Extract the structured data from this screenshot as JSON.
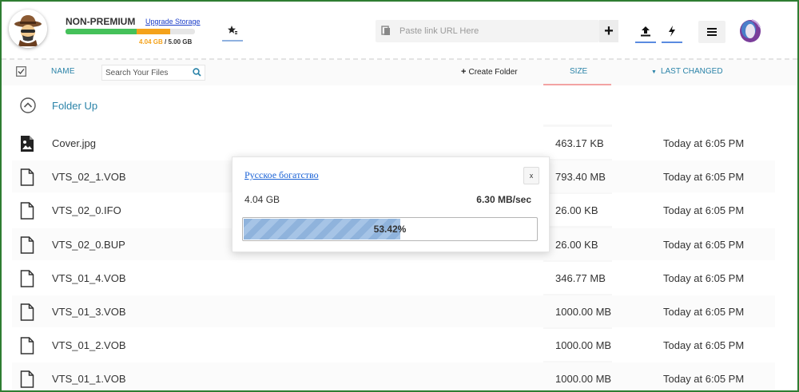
{
  "header": {
    "plan_label": "NON-PREMIUM",
    "upgrade_label": "Upgrade Storage",
    "storage_used": "4.04 GB",
    "storage_separator": " / ",
    "storage_total": "5.00 GB",
    "storage_fraction": 0.808,
    "url_placeholder": "Paste link URL Here",
    "add_label": "+"
  },
  "toolbar": {
    "name_label": "NAME",
    "search_placeholder": "Search Your Files",
    "create_folder_label": "Create Folder",
    "size_label": "SIZE",
    "last_changed_label": "LAST CHANGED"
  },
  "list": {
    "folder_up_label": "Folder Up",
    "files": [
      {
        "name": "Cover.jpg",
        "size": "463.17 KB",
        "date": "Today at 6:05 PM",
        "icon": "image-file-icon"
      },
      {
        "name": "VTS_02_1.VOB",
        "size": "793.40 MB",
        "date": "Today at 6:05 PM",
        "icon": "file-icon"
      },
      {
        "name": "VTS_02_0.IFO",
        "size": "26.00 KB",
        "date": "Today at 6:05 PM",
        "icon": "file-icon"
      },
      {
        "name": "VTS_02_0.BUP",
        "size": "26.00 KB",
        "date": "Today at 6:05 PM",
        "icon": "file-icon"
      },
      {
        "name": "VTS_01_4.VOB",
        "size": "346.77 MB",
        "date": "Today at 6:05 PM",
        "icon": "file-icon"
      },
      {
        "name": "VTS_01_3.VOB",
        "size": "1000.00 MB",
        "date": "Today at 6:05 PM",
        "icon": "file-icon"
      },
      {
        "name": "VTS_01_2.VOB",
        "size": "1000.00 MB",
        "date": "Today at 6:05 PM",
        "icon": "file-icon"
      },
      {
        "name": "VTS_01_1.VOB",
        "size": "1000.00 MB",
        "date": "Today at 6:05 PM",
        "icon": "file-icon"
      }
    ]
  },
  "dialog": {
    "title": "Русское богатство",
    "close_label": "x",
    "size": "4.04 GB",
    "speed": "6.30 MB/sec",
    "progress_label": "53.42%",
    "progress_fraction": 0.5342
  },
  "colors": {
    "accent": "#2a83a8",
    "storage_green": "#45c15a",
    "storage_orange": "#f4a21a",
    "frame": "#2e7d32"
  }
}
